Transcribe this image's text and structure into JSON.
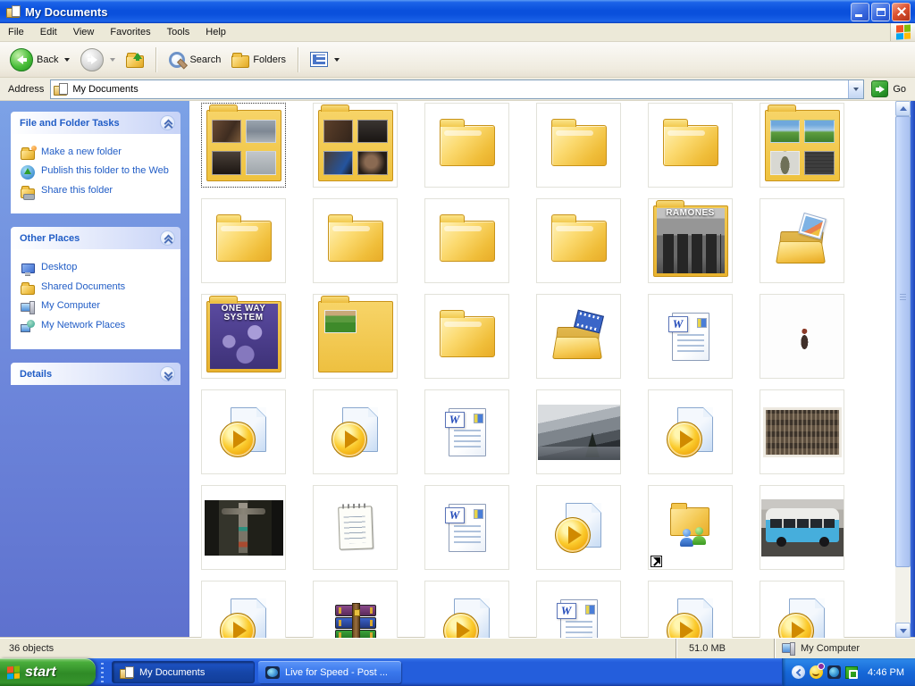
{
  "window": {
    "title": "My Documents"
  },
  "menubar": {
    "items": [
      "File",
      "Edit",
      "View",
      "Favorites",
      "Tools",
      "Help"
    ]
  },
  "toolbar": {
    "back": "Back",
    "search": "Search",
    "folders": "Folders"
  },
  "addressbar": {
    "label": "Address",
    "value": "My Documents",
    "go": "Go"
  },
  "sidebar": {
    "panels": [
      {
        "title": "File and Folder Tasks",
        "items": [
          {
            "icon": "new-folder-icon",
            "label": "Make a new folder"
          },
          {
            "icon": "publish-web-icon",
            "label": "Publish this folder to the Web"
          },
          {
            "icon": "share-folder-icon",
            "label": "Share this folder"
          }
        ]
      },
      {
        "title": "Other Places",
        "items": [
          {
            "icon": "desktop-icon",
            "label": "Desktop"
          },
          {
            "icon": "shared-documents-icon",
            "label": "Shared Documents"
          },
          {
            "icon": "my-computer-icon",
            "label": "My Computer"
          },
          {
            "icon": "network-places-icon",
            "label": "My Network Places"
          }
        ]
      },
      {
        "title": "Details",
        "items": []
      }
    ]
  },
  "icons": {
    "word_letter": "W"
  },
  "content": {
    "items": [
      {
        "type": "photo-folder",
        "name": "photo-folder",
        "selected": true,
        "photos": [
          "interior-dark",
          "overhead-gray",
          "portrait-dark",
          "rink-gray"
        ]
      },
      {
        "type": "photo-folder",
        "name": "photo-folder",
        "photos": [
          "bar-dark",
          "couple-dark",
          "friends-dark",
          "face-dark"
        ]
      },
      {
        "type": "folder",
        "name": "folder"
      },
      {
        "type": "folder",
        "name": "folder"
      },
      {
        "type": "folder",
        "name": "folder"
      },
      {
        "type": "photo-folder",
        "name": "screenshots-folder",
        "photos": [
          "bliss",
          "bliss",
          "figure-gray",
          "grid-dark"
        ]
      },
      {
        "type": "folder",
        "name": "folder"
      },
      {
        "type": "folder",
        "name": "folder"
      },
      {
        "type": "folder",
        "name": "folder"
      },
      {
        "type": "folder",
        "name": "folder"
      },
      {
        "type": "cover-folder",
        "name": "ramones-album-folder",
        "cover": "ramones",
        "label": "RAMONES"
      },
      {
        "type": "pictures-folder",
        "name": "pictures-folder"
      },
      {
        "type": "cover-folder",
        "name": "oneway-album-folder",
        "cover": "oneway",
        "label": "ONE WAY SYSTEM"
      },
      {
        "type": "grass-folder",
        "name": "preview-folder"
      },
      {
        "type": "folder",
        "name": "folder"
      },
      {
        "type": "videos-folder",
        "name": "videos-folder"
      },
      {
        "type": "word-doc",
        "name": "word-document"
      },
      {
        "type": "photo",
        "name": "person-photo",
        "variant": "person"
      },
      {
        "type": "media-file",
        "name": "media-file"
      },
      {
        "type": "media-file",
        "name": "media-file"
      },
      {
        "type": "word-doc",
        "name": "word-document"
      },
      {
        "type": "photo",
        "name": "mountain-photo",
        "variant": "mountain"
      },
      {
        "type": "media-file",
        "name": "media-file"
      },
      {
        "type": "photo",
        "name": "group-photo",
        "variant": "group"
      },
      {
        "type": "photo",
        "name": "totem-photo",
        "variant": "totem"
      },
      {
        "type": "notepad-file",
        "name": "text-file"
      },
      {
        "type": "word-doc",
        "name": "word-document"
      },
      {
        "type": "media-file",
        "name": "media-file"
      },
      {
        "type": "shared-folder",
        "name": "shared-folder-shortcut"
      },
      {
        "type": "photo",
        "name": "van-photo",
        "variant": "van"
      },
      {
        "type": "media-file",
        "name": "media-file"
      },
      {
        "type": "winrar-file",
        "name": "archive-file"
      },
      {
        "type": "media-file",
        "name": "media-file"
      },
      {
        "type": "word-doc",
        "name": "word-document"
      },
      {
        "type": "media-file",
        "name": "media-file"
      },
      {
        "type": "media-file",
        "name": "media-file"
      }
    ]
  },
  "statusbar": {
    "left": "36 objects",
    "size": "51.0 MB",
    "zone": "My Computer"
  },
  "taskbar": {
    "start": "start",
    "tasks": [
      {
        "label": "My Documents",
        "icon": "my-documents",
        "active": true
      },
      {
        "label": "Live for Speed - Post ...",
        "icon": "browser",
        "active": false
      }
    ],
    "time": "4:46 PM"
  },
  "colors": {
    "titlebar_blue": "#0A50DC",
    "taskbar_blue": "#245EDC",
    "start_green": "#2F8A26",
    "link_blue": "#215DC6",
    "folder_gold": "#EFC23E"
  }
}
